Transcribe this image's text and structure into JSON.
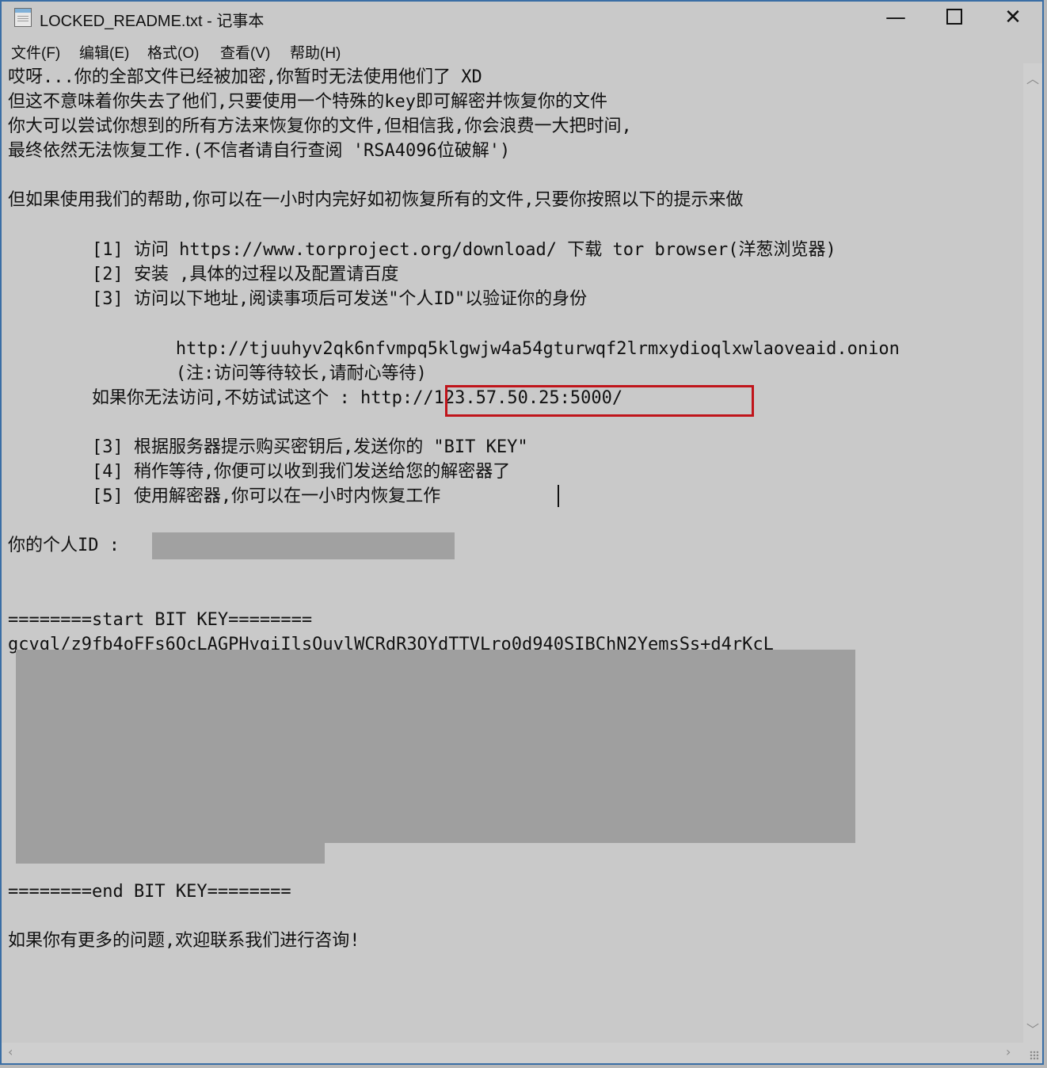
{
  "window": {
    "title": "LOCKED_README.txt - 记事本",
    "minimize": "—",
    "close": "✕"
  },
  "menu": [
    "文件(F)",
    "编辑(E)",
    "格式(O)",
    "查看(V)",
    "帮助(H)"
  ],
  "document": {
    "lines": [
      "哎呀...你的全部文件已经被加密,你暂时无法使用他们了 XD",
      "但这不意味着你失去了他们,只要使用一个特殊的key即可解密并恢复你的文件",
      "你大可以尝试你想到的所有方法来恢复你的文件,但相信我,你会浪费一大把时间,",
      "最终依然无法恢复工作.(不信者请自行查阅 'RSA4096位破解')",
      "但如果使用我们的帮助,你可以在一小时内完好如初恢复所有的文件,只要你按照以下的提示来做",
      "        [1] 访问 https://www.torproject.org/download/ 下载 tor browser(洋葱浏览器)",
      "        [2] 安装 ,具体的过程以及配置请百度",
      "        [3] 访问以下地址,阅读事项后可发送\"个人ID\"以验证你的身份",
      "                http://tjuuhyv2qk6nfvmpq5klgwjw4a54gturwqf2lrmxydioqlxwlaoveaid.onion",
      "                (注:访问等待较长,请耐心等待)",
      "        如果你无法访问,不妨试试这个 : http://123.57.50.25:5000/",
      "        [3] 根据服务器提示购买密钥后,发送你的 \"BIT KEY\"",
      "        [4] 稍作等待,你便可以收到我们发送给您的解密器了",
      "        [5] 使用解密器,你可以在一小时内恢复工作",
      "你的个人ID :",
      "========start BIT KEY========",
      "gcvgl/z9fb4oFFs6OcLAGPHvgiIlsOuvlWCRdR3OYdTTVLro0d940SIBChN2YemsSs+d4rKcL",
      "========end BIT KEY========",
      "如果你有更多的问题,欢迎联系我们进行咨询!"
    ]
  }
}
